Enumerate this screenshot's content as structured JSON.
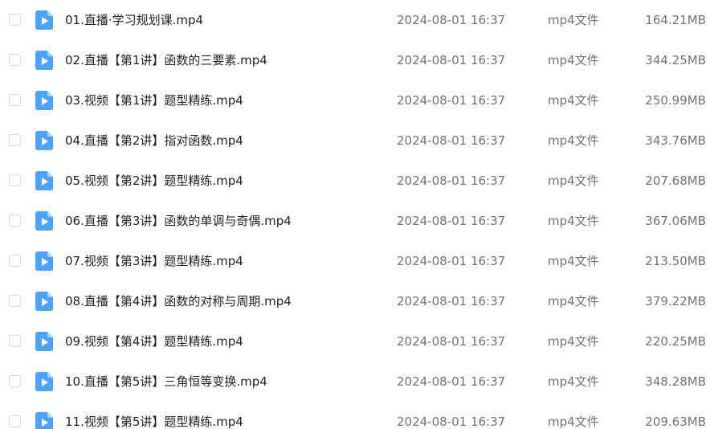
{
  "files": [
    {
      "name": "01.直播·学习规划课.mp4",
      "date": "2024-08-01 16:37",
      "type": "mp4文件",
      "size": "164.21MB"
    },
    {
      "name": "02.直播【第1讲】函数的三要素.mp4",
      "date": "2024-08-01 16:37",
      "type": "mp4文件",
      "size": "344.25MB"
    },
    {
      "name": "03.视频【第1讲】题型精练.mp4",
      "date": "2024-08-01 16:37",
      "type": "mp4文件",
      "size": "250.99MB"
    },
    {
      "name": "04.直播【第2讲】指对函数.mp4",
      "date": "2024-08-01 16:37",
      "type": "mp4文件",
      "size": "343.76MB"
    },
    {
      "name": "05.视频【第2讲】题型精练.mp4",
      "date": "2024-08-01 16:37",
      "type": "mp4文件",
      "size": "207.68MB"
    },
    {
      "name": "06.直播【第3讲】函数的单调与奇偶.mp4",
      "date": "2024-08-01 16:37",
      "type": "mp4文件",
      "size": "367.06MB"
    },
    {
      "name": "07.视频【第3讲】题型精练.mp4",
      "date": "2024-08-01 16:37",
      "type": "mp4文件",
      "size": "213.50MB"
    },
    {
      "name": "08.直播【第4讲】函数的对称与周期.mp4",
      "date": "2024-08-01 16:37",
      "type": "mp4文件",
      "size": "379.22MB"
    },
    {
      "name": "09.视频【第4讲】题型精练.mp4",
      "date": "2024-08-01 16:37",
      "type": "mp4文件",
      "size": "220.25MB"
    },
    {
      "name": "10.直播【第5讲】三角恒等变换.mp4",
      "date": "2024-08-01 16:37",
      "type": "mp4文件",
      "size": "348.28MB"
    },
    {
      "name": "11.视频【第5讲】题型精练.mp4",
      "date": "2024-08-01 16:37",
      "type": "mp4文件",
      "size": "209.63MB"
    }
  ],
  "icon": "video-file-icon",
  "colors": {
    "icon_main": "#4da3ff",
    "icon_fold": "#a9d2ff",
    "text_primary": "#222222",
    "text_secondary": "#737373",
    "checkbox_border": "#d6d9df"
  }
}
